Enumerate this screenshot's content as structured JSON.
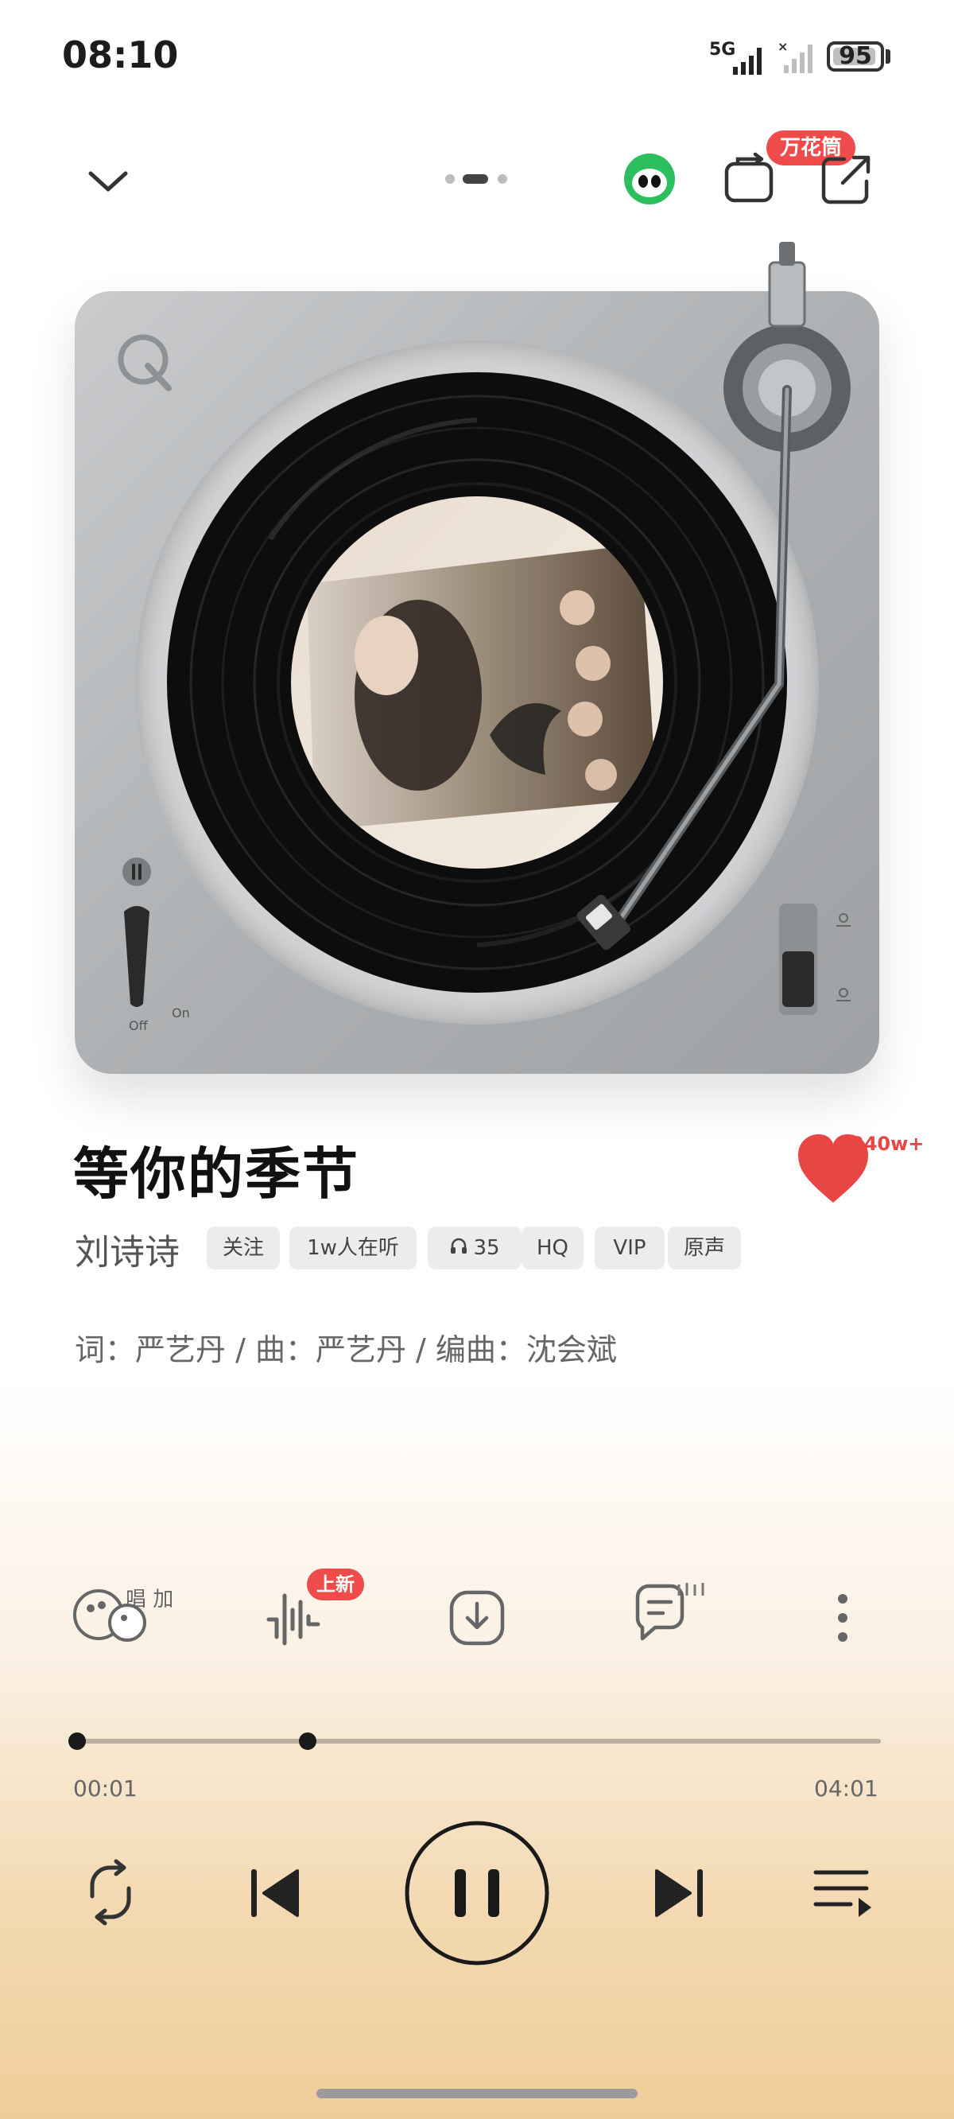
{
  "status": {
    "time": "08:10",
    "network": "5G",
    "battery": "95",
    "battery_level": 0.95
  },
  "topbar": {
    "badge": "万花筒",
    "page_count": 3,
    "active_page": 1
  },
  "song": {
    "title": "等你的季节",
    "artist": "刘诗诗",
    "like_count": "240w+",
    "tags": {
      "follow": "关注",
      "listeners": "1w人在听",
      "listen_count": "35",
      "quality": "HQ",
      "vip": "VIP",
      "original": "原声"
    },
    "credits": "词：严艺丹 / 曲：严艺丹 / 编曲：沈会斌"
  },
  "turntable": {
    "switch_off": "Off",
    "switch_on": "On"
  },
  "actions": {
    "sing_label": "唱 加",
    "new_badge": "上新"
  },
  "progress": {
    "current": "00:01",
    "total": "04:01",
    "fraction": 0.004,
    "buffered": 0.29
  },
  "colors": {
    "accent_red": "#ef4b4b",
    "heart": "#e84545",
    "mascot_green": "#2dbf5e"
  }
}
